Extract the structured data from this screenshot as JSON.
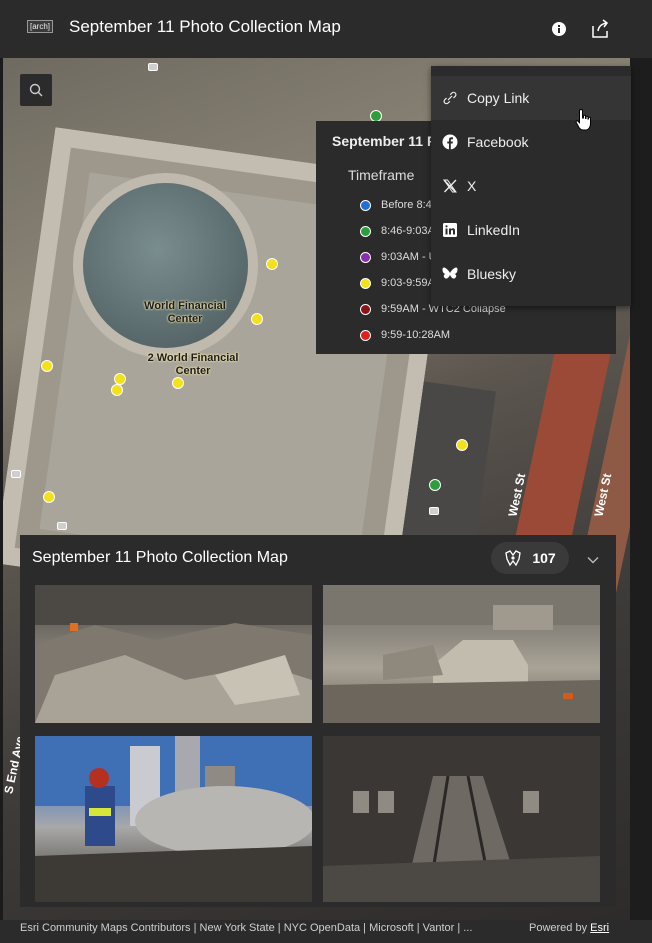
{
  "header": {
    "logo_text": "[arch]",
    "title": "September 11 Photo Collection Map",
    "info_icon": "info-icon",
    "share_icon": "share-icon"
  },
  "map": {
    "labels": [
      "World Financial\nCenter",
      "2 World Financial\nCenter"
    ],
    "streets": [
      "West St",
      "West St",
      "S End Ave"
    ],
    "search_icon": "search-icon"
  },
  "legend": {
    "title": "September 11 Photo Collection Map",
    "subtitle": "Timeframe",
    "items": [
      {
        "label": "Before 8:46AM",
        "color": "#1f6fd6"
      },
      {
        "label": "8:46-9:03AM",
        "color": "#2e9e3c"
      },
      {
        "label": "9:03AM - UA 175",
        "color": "#8d2bb3"
      },
      {
        "label": "9:03-9:59AM",
        "color": "#f3e21b"
      },
      {
        "label": "9:59AM - WTC2 Collapse",
        "color": "#8a1515"
      },
      {
        "label": "9:59-10:28AM",
        "color": "#e02020"
      }
    ]
  },
  "share_menu": {
    "items": [
      {
        "label": "Copy Link",
        "icon": "link-icon"
      },
      {
        "label": "Facebook",
        "icon": "facebook-icon"
      },
      {
        "label": "X",
        "icon": "x-icon"
      },
      {
        "label": "LinkedIn",
        "icon": "linkedin-icon"
      },
      {
        "label": "Bluesky",
        "icon": "bluesky-icon"
      }
    ]
  },
  "panel": {
    "title": "September 11 Photo Collection Map",
    "count": "107",
    "count_icon": "camera-group-icon",
    "collapse_icon": "chevron-down-icon"
  },
  "attribution": {
    "left": "Esri Community Maps Contributors | New York State | NYC OpenData | Microsoft | Vantor | ...",
    "powered_by": "Powered by",
    "esri": "Esri"
  }
}
